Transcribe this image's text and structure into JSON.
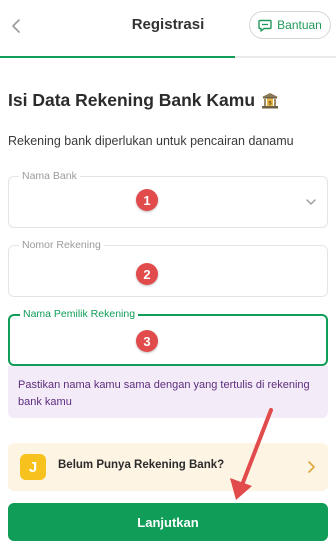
{
  "header": {
    "back_icon": "chevron-left-icon",
    "title": "Registrasi",
    "help_label": "Bantuan",
    "help_icon": "chat-bubble-icon",
    "progress_fraction": 0.7
  },
  "headline": {
    "title": "Isi Data Rekening Bank Kamu",
    "icon": "bank-icon",
    "subtitle": "Rekening bank diperlukan untuk pencairan danamu"
  },
  "form": {
    "bank_name": {
      "label": "Nama Bank",
      "value": "",
      "icon": "chevron-down-icon"
    },
    "account_number": {
      "label": "Nomor Rekening",
      "value": ""
    },
    "account_holder": {
      "label": "Nama Pemilik Rekening",
      "value": ""
    }
  },
  "annotations": {
    "markers": [
      "1",
      "2",
      "3"
    ],
    "marker_color": "#e14b4b"
  },
  "hint": {
    "text": "Pastikan nama kamu sama dengan yang tertulis di rekening bank kamu"
  },
  "promo": {
    "icon_letter": "J",
    "text": "Belum Punya Rekening Bank?",
    "icon": "chevron-right-icon"
  },
  "submit": {
    "label": "Lanjutkan"
  },
  "colors": {
    "accent": "#0f9d58",
    "hint_bg": "#f3ecf8",
    "hint_text": "#5e2c7e",
    "promo_bg": "#fdf4e3",
    "promo_icon_bg": "#f8c21e"
  }
}
